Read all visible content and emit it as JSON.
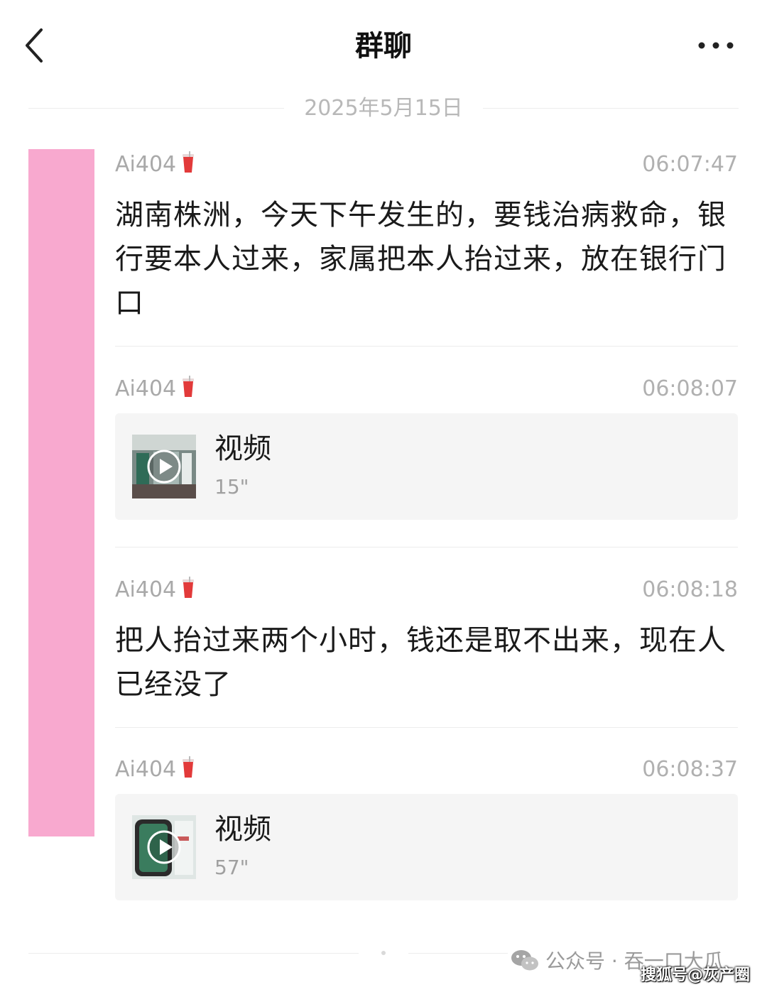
{
  "header": {
    "title": "群聊"
  },
  "date_separator": "2025年5月15日",
  "messages": [
    {
      "sender": "Ai404",
      "time": "06:07:47",
      "text": "湖南株洲，今天下午发生的，要钱治病救命，银行要本人过来，家属把本人抬过来，放在银行门口"
    },
    {
      "sender": "Ai404",
      "time": "06:08:07",
      "video_label": "视频",
      "video_duration": "15\""
    },
    {
      "sender": "Ai404",
      "time": "06:08:18",
      "text": "把人抬过来两个小时，钱还是取不出来，现在人已经没了"
    },
    {
      "sender": "Ai404",
      "time": "06:08:37",
      "video_label": "视频",
      "video_duration": "57\""
    }
  ],
  "watermarks": {
    "official_account": "公众号 · 吞一口大瓜",
    "sohu": "搜狐号@灰产圈"
  },
  "colors": {
    "pink_bar": "#f8a9cf",
    "card_bg": "#f5f5f5",
    "muted_text": "#b0b0b0"
  }
}
